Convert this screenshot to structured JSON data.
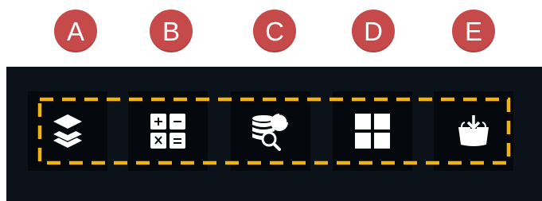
{
  "labels": [
    "A",
    "B",
    "C",
    "D",
    "E"
  ],
  "toolbar": {
    "tools": [
      {
        "icon": "layers-icon"
      },
      {
        "icon": "calculator-icon"
      },
      {
        "icon": "database-search-report-icon"
      },
      {
        "icon": "grid-widgets-icon"
      },
      {
        "icon": "basket-add-icon"
      }
    ]
  },
  "colors": {
    "badge": "#c64a49",
    "badge_text": "#ffffff",
    "toolbar_bg": "#0b121a",
    "button_bg": "#05090e",
    "highlight_dash": "#f2b310",
    "icon": "#ffffff"
  }
}
